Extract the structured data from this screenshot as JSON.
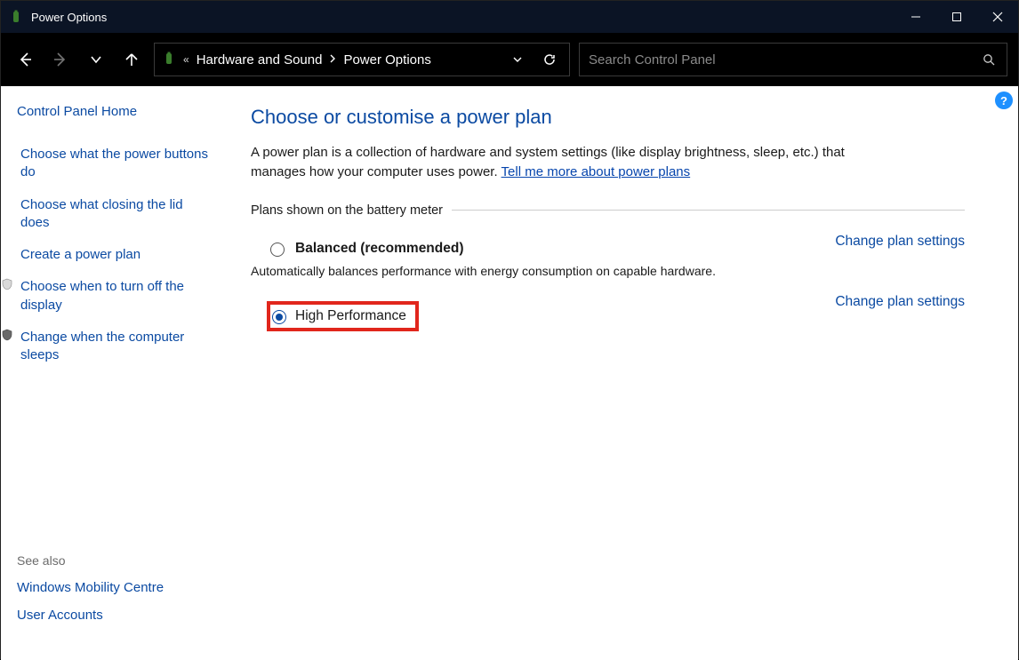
{
  "window": {
    "title": "Power Options"
  },
  "breadcrumb": {
    "item1": "Hardware and Sound",
    "item2": "Power Options"
  },
  "search": {
    "placeholder": "Search Control Panel"
  },
  "sidebar": {
    "home": "Control Panel Home",
    "links": [
      {
        "label": "Choose what the power buttons do"
      },
      {
        "label": "Choose what closing the lid does"
      },
      {
        "label": "Create a power plan"
      },
      {
        "label": "Choose when to turn off the display"
      },
      {
        "label": "Change when the computer sleeps"
      }
    ]
  },
  "see_also": {
    "heading": "See also",
    "links": [
      {
        "label": "Windows Mobility Centre"
      },
      {
        "label": "User Accounts"
      }
    ]
  },
  "main": {
    "heading": "Choose or customise a power plan",
    "desc_pre": "A power plan is a collection of hardware and system settings (like display brightness, sleep, etc.) that manages how your computer uses power. ",
    "desc_link": "Tell me more about power plans",
    "fieldset": "Plans shown on the battery meter",
    "plans": [
      {
        "name": "Balanced (recommended)",
        "desc": "Automatically balances performance with energy consumption on capable hardware.",
        "change": "Change plan settings",
        "selected": false
      },
      {
        "name": "High Performance",
        "change": "Change plan settings",
        "selected": true
      }
    ]
  }
}
